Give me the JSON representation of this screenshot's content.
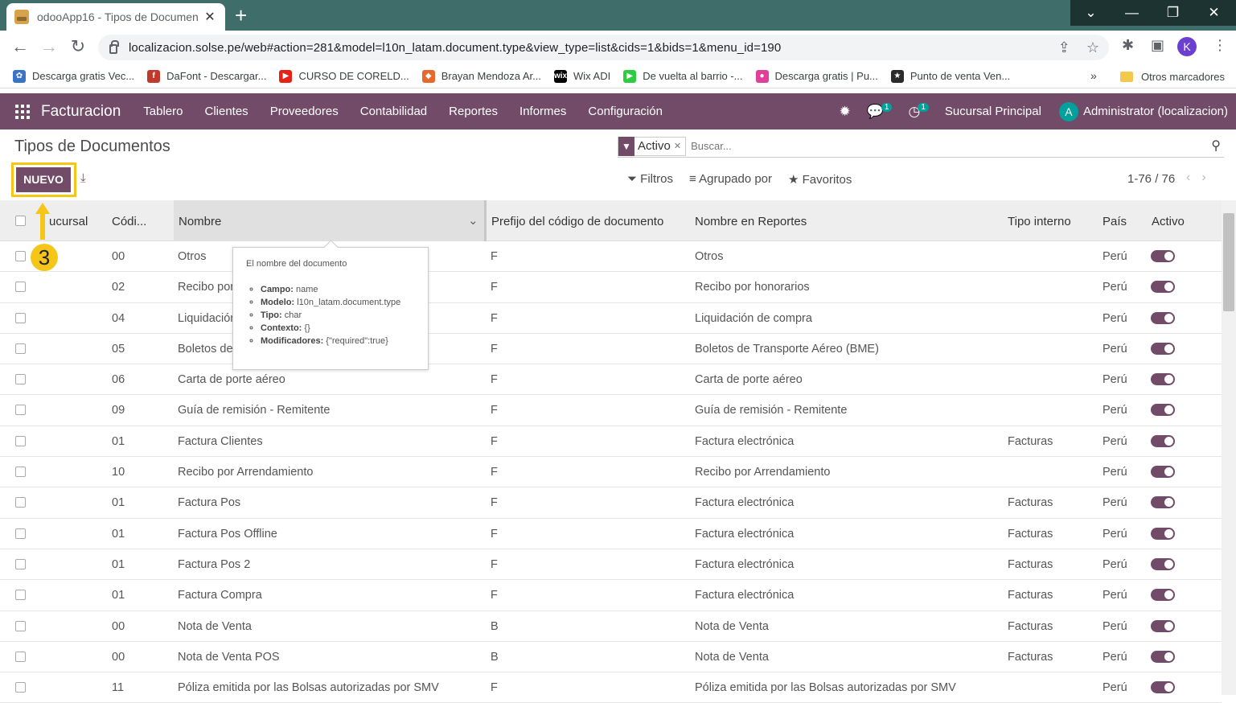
{
  "browser": {
    "tab_title": "odooApp16 - Tipos de Documen",
    "url": "localizacion.solse.pe/web#action=281&model=l10n_latam.document.type&view_type=list&cids=1&bids=1&menu_id=190",
    "profile_initial": "K",
    "bookmarks": [
      {
        "label": "Descarga gratis Vec...",
        "color": "#3b73c8",
        "glyph": "✿"
      },
      {
        "label": "DaFont - Descargar...",
        "color": "#c0392b",
        "glyph": "f"
      },
      {
        "label": "CURSO DE CORELD...",
        "color": "#e62117",
        "glyph": "▶"
      },
      {
        "label": "Brayan Mendoza Ar...",
        "color": "#e8672a",
        "glyph": "◆"
      },
      {
        "label": "Wix ADI",
        "color": "#000000",
        "glyph": "wix"
      },
      {
        "label": "De vuelta al barrio -...",
        "color": "#2ecc40",
        "glyph": "▶"
      },
      {
        "label": "Descarga gratis | Pu...",
        "color": "#e0409a",
        "glyph": "●"
      },
      {
        "label": "Punto de venta Ven...",
        "color": "#2b2b2b",
        "glyph": "★"
      }
    ],
    "bookmarks_more": "»",
    "other_bookmarks": "Otros marcadores"
  },
  "navbar": {
    "app_name": "Facturacion",
    "menu": [
      "Tablero",
      "Clientes",
      "Proveedores",
      "Contabilidad",
      "Reportes",
      "Informes",
      "Configuración"
    ],
    "messages_badge": "1",
    "activity_badge": "1",
    "branch": "Sucursal Principal",
    "user_initial": "A",
    "user": "Administrator (localizacion)"
  },
  "control_panel": {
    "title": "Tipos de Documentos",
    "facet": "Activo",
    "search_placeholder": "Buscar...",
    "new_button": "NUEVO",
    "filters": "Filtros",
    "group_by": "Agrupado por",
    "favorites": "Favoritos",
    "pager": "1-76 / 76"
  },
  "table": {
    "headers": {
      "sucursal": "ucursal",
      "codigo": "Códi...",
      "nombre": "Nombre",
      "prefijo": "Prefijo del código de documento",
      "nombre_reportes": "Nombre en Reportes",
      "tipo": "Tipo interno",
      "pais": "País",
      "activo": "Activo"
    },
    "rows": [
      {
        "code": "00",
        "name": "Otros",
        "prefix": "F",
        "report": "Otros",
        "type": "",
        "country": "Perú"
      },
      {
        "code": "02",
        "name": "Recibo por",
        "prefix": "F",
        "report": "Recibo por honorarios",
        "type": "",
        "country": "Perú"
      },
      {
        "code": "04",
        "name": "Liquidación",
        "prefix": "F",
        "report": "Liquidación de compra",
        "type": "",
        "country": "Perú"
      },
      {
        "code": "05",
        "name": "Boletos de",
        "prefix": "F",
        "report": "Boletos de Transporte Aéreo (BME)",
        "type": "",
        "country": "Perú"
      },
      {
        "code": "06",
        "name": "Carta de porte aéreo",
        "prefix": "F",
        "report": "Carta de porte aéreo",
        "type": "",
        "country": "Perú"
      },
      {
        "code": "09",
        "name": "Guía de remisión - Remitente",
        "prefix": "F",
        "report": "Guía de remisión - Remitente",
        "type": "",
        "country": "Perú"
      },
      {
        "code": "01",
        "name": "Factura Clientes",
        "prefix": "F",
        "report": "Factura electrónica",
        "type": "Facturas",
        "country": "Perú"
      },
      {
        "code": "10",
        "name": "Recibo por Arrendamiento",
        "prefix": "F",
        "report": "Recibo por Arrendamiento",
        "type": "",
        "country": "Perú"
      },
      {
        "code": "01",
        "name": "Factura Pos",
        "prefix": "F",
        "report": "Factura electrónica",
        "type": "Facturas",
        "country": "Perú"
      },
      {
        "code": "01",
        "name": "Factura Pos Offline",
        "prefix": "F",
        "report": "Factura electrónica",
        "type": "Facturas",
        "country": "Perú"
      },
      {
        "code": "01",
        "name": "Factura Pos 2",
        "prefix": "F",
        "report": "Factura electrónica",
        "type": "Facturas",
        "country": "Perú"
      },
      {
        "code": "01",
        "name": "Factura Compra",
        "prefix": "F",
        "report": "Factura electrónica",
        "type": "Facturas",
        "country": "Perú"
      },
      {
        "code": "00",
        "name": "Nota de Venta",
        "prefix": "B",
        "report": "Nota de Venta",
        "type": "Facturas",
        "country": "Perú"
      },
      {
        "code": "00",
        "name": "Nota de Venta POS",
        "prefix": "B",
        "report": "Nota de Venta",
        "type": "Facturas",
        "country": "Perú"
      },
      {
        "code": "11",
        "name": "Póliza emitida por las Bolsas autorizadas por SMV",
        "prefix": "F",
        "report": "Póliza emitida por las Bolsas autorizadas por SMV",
        "type": "",
        "country": "Perú"
      }
    ]
  },
  "tooltip": {
    "title": "El nombre del documento",
    "items": [
      {
        "label": "Campo:",
        "value": "name"
      },
      {
        "label": "Modelo:",
        "value": "l10n_latam.document.type"
      },
      {
        "label": "Tipo:",
        "value": "char"
      },
      {
        "label": "Contexto:",
        "value": "{}"
      },
      {
        "label": "Modificadores:",
        "value": "{\"required\":true}"
      }
    ]
  },
  "annotation": {
    "step": "3",
    "color": "#f5c518"
  },
  "colors": {
    "odoo_primary": "#714b67",
    "chrome_frame": "#3f6d6a"
  }
}
